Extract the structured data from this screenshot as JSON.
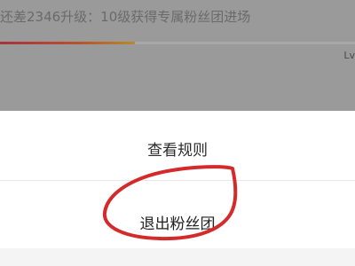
{
  "background_page": {
    "upgrade_text": "还差2346升级：10级获得专属粉丝团进场",
    "level_label": "Lv",
    "progress_fraction": 0.38,
    "progress_color": "#b9532c"
  },
  "sheet": {
    "view_rules_label": "查看规则",
    "exit_fan_club_label": "退出粉丝团"
  },
  "annotation": {
    "color": "#d42a2a"
  }
}
